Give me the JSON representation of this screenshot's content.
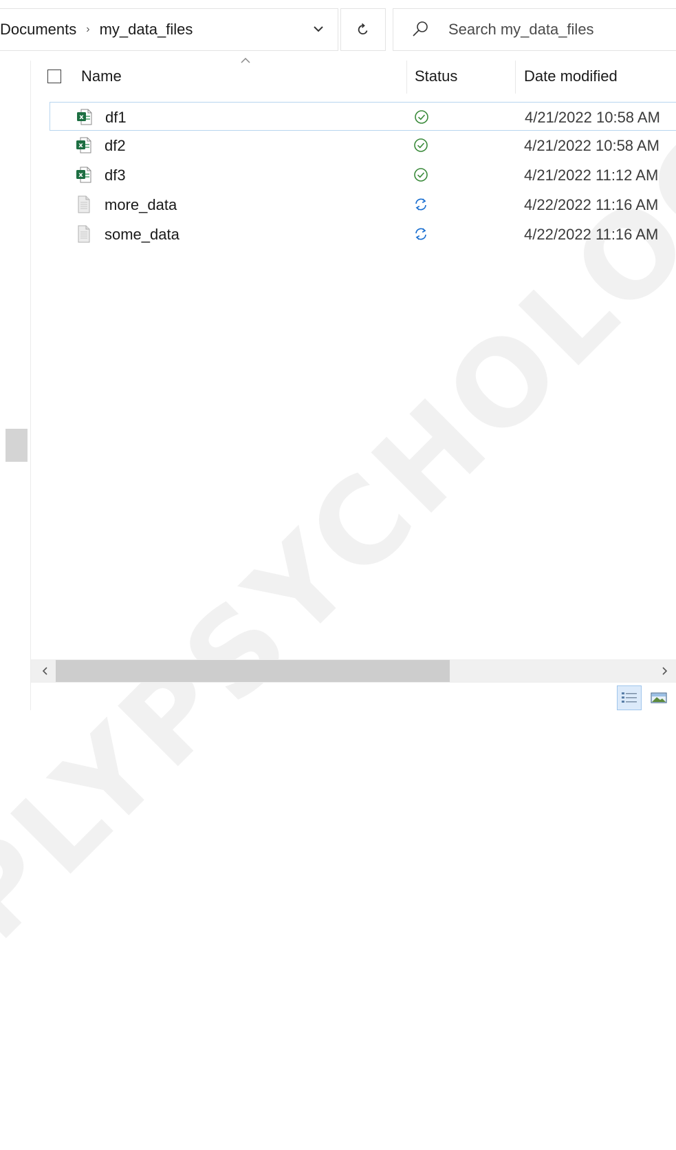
{
  "address_bar": {
    "breadcrumbs": [
      "Documents",
      "my_data_files"
    ],
    "separator_icon": "chevron-right-icon",
    "dropdown_icon": "chevron-down-icon",
    "refresh_icon": "refresh-icon"
  },
  "search": {
    "placeholder": "Search my_data_files",
    "icon": "search-icon"
  },
  "columns": {
    "name": "Name",
    "status": "Status",
    "date_modified": "Date modified",
    "sort_icon": "chevron-up-icon"
  },
  "files": [
    {
      "name": "df1",
      "type": "excel",
      "status": "synced",
      "date": "4/21/2022 10:58 AM",
      "selected": true
    },
    {
      "name": "df2",
      "type": "excel",
      "status": "synced",
      "date": "4/21/2022 10:58 AM",
      "selected": false
    },
    {
      "name": "df3",
      "type": "excel",
      "status": "synced",
      "date": "4/21/2022 11:12 AM",
      "selected": false
    },
    {
      "name": "more_data",
      "type": "text",
      "status": "syncing",
      "date": "4/22/2022 11:16 AM",
      "selected": false
    },
    {
      "name": "some_data",
      "type": "text",
      "status": "syncing",
      "date": "4/22/2022 11:16 AM",
      "selected": false
    }
  ],
  "scrollbar": {
    "left_icon": "chevron-left-icon",
    "right_icon": "chevron-right-icon",
    "position_fraction": 0.0,
    "visible_fraction": 0.66
  },
  "view_buttons": {
    "details_icon": "details-view-icon",
    "thumbnails_icon": "large-icons-view-icon",
    "active": "details"
  },
  "colors": {
    "synced_green": "#3a8a3a",
    "syncing_blue": "#1a6fd1",
    "excel_green": "#1d6f42",
    "selection_border": "#b7d5ef"
  },
  "watermark_text": "SIMPLYPSYCHOLOGY.ORG"
}
